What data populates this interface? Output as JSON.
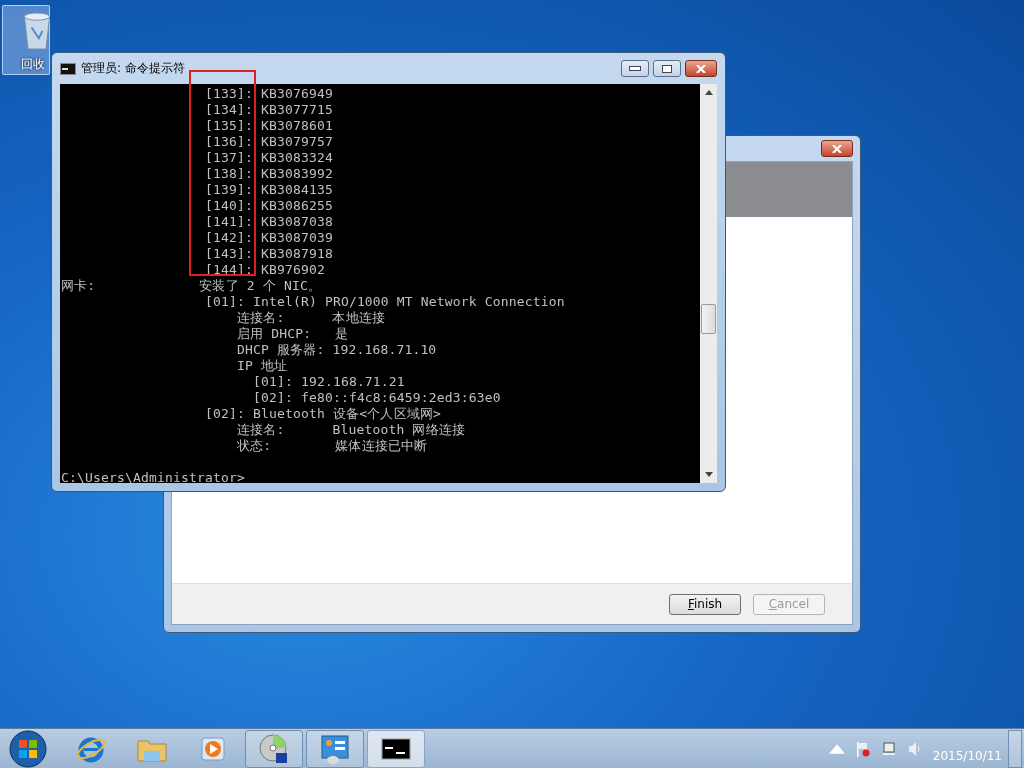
{
  "desktop_icons": [
    {
      "label": "回收",
      "selected": true
    }
  ],
  "wizard_window": {
    "buttons": [
      {
        "label": "Finish",
        "disabled": false
      },
      {
        "label": "Cancel",
        "disabled": true
      }
    ]
  },
  "cmd_window": {
    "title": "管理员: 命令提示符",
    "lines": [
      "                  [133]: KB3076949",
      "                  [134]: KB3077715",
      "                  [135]: KB3078601",
      "                  [136]: KB3079757",
      "                  [137]: KB3083324",
      "                  [138]: KB3083992",
      "                  [139]: KB3084135",
      "                  [140]: KB3086255",
      "                  [141]: KB3087038",
      "                  [142]: KB3087039",
      "                  [143]: KB3087918",
      "                  [144]: KB976902",
      "网卡:             安装了 2 个 NIC。",
      "                  [01]: Intel(R) PRO/1000 MT Network Connection",
      "                      连接名:      本地连接",
      "                      启用 DHCP:   是",
      "                      DHCP 服务器: 192.168.71.10",
      "                      IP 地址",
      "                        [01]: 192.168.71.21",
      "                        [02]: fe80::f4c8:6459:2ed3:63e0",
      "                  [02]: Bluetooth 设备<个人区域网>",
      "                      连接名:      Bluetooth 网络连接",
      "                      状态:        媒体连接已中断",
      "C:\\Users\\Administrator>"
    ]
  },
  "taskbar": {
    "apps": [
      {
        "kind": "browser",
        "running": false,
        "selected": false
      },
      {
        "kind": "folder",
        "running": false,
        "selected": false
      },
      {
        "kind": "media",
        "running": false,
        "selected": false
      },
      {
        "kind": "disc",
        "running": true,
        "selected": false
      },
      {
        "kind": "panel",
        "running": true,
        "selected": false
      },
      {
        "kind": "console",
        "running": true,
        "selected": true
      }
    ],
    "date": "2015/10/11"
  }
}
